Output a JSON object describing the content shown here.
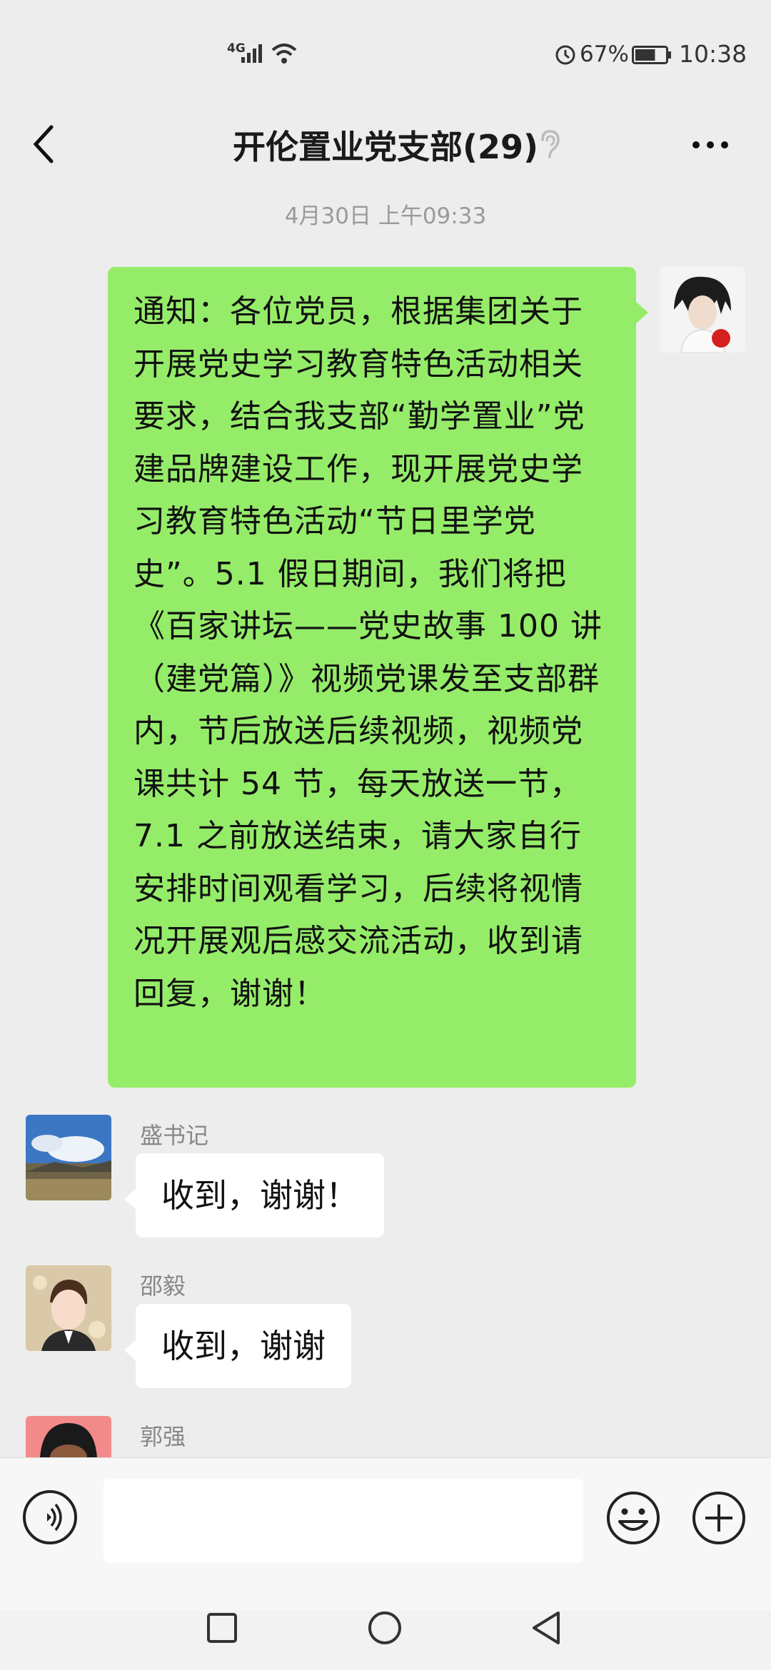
{
  "status_bar": {
    "network": "4G",
    "battery_percent": "67%",
    "time": "10:38",
    "battery_level": 0.67
  },
  "header": {
    "title": "开伦置业党支部(29)"
  },
  "timestamp": "4月30日 上午09:33",
  "my_message": {
    "text": "通知：各位党员，根据集团关于开展党史学习教育特色活动相关要求，结合我支部“勤学置业”党建品牌建设工作，现开展党史学习教育特色活动“节日里学党史”。5.1 假日期间，我们将把《百家讲坛——党史故事 100 讲（建党篇）》视频党课发至支部群内，节后放送后续视频，视频党课共计 54 节，每天放送一节，7.1 之前放送结束，请大家自行安排时间观看学习，后续将视情况开展观后感交流活动，收到请回复，谢谢！"
  },
  "messages": [
    {
      "sender": "盛书记",
      "text": "收到，谢谢！"
    },
    {
      "sender": "邵毅",
      "text": "收到，谢谢"
    },
    {
      "sender": "郭强",
      "text": ""
    }
  ],
  "input": {
    "value": "",
    "placeholder": ""
  },
  "icons": {
    "back": "back-chevron-icon",
    "mute": "ear-icon",
    "more": "more-dots-icon",
    "voice": "voice-icon",
    "emoji": "emoji-icon",
    "plus": "plus-icon"
  },
  "colors": {
    "my_bubble": "#95ec69",
    "other_bubble": "#ffffff",
    "background": "#ededed"
  }
}
